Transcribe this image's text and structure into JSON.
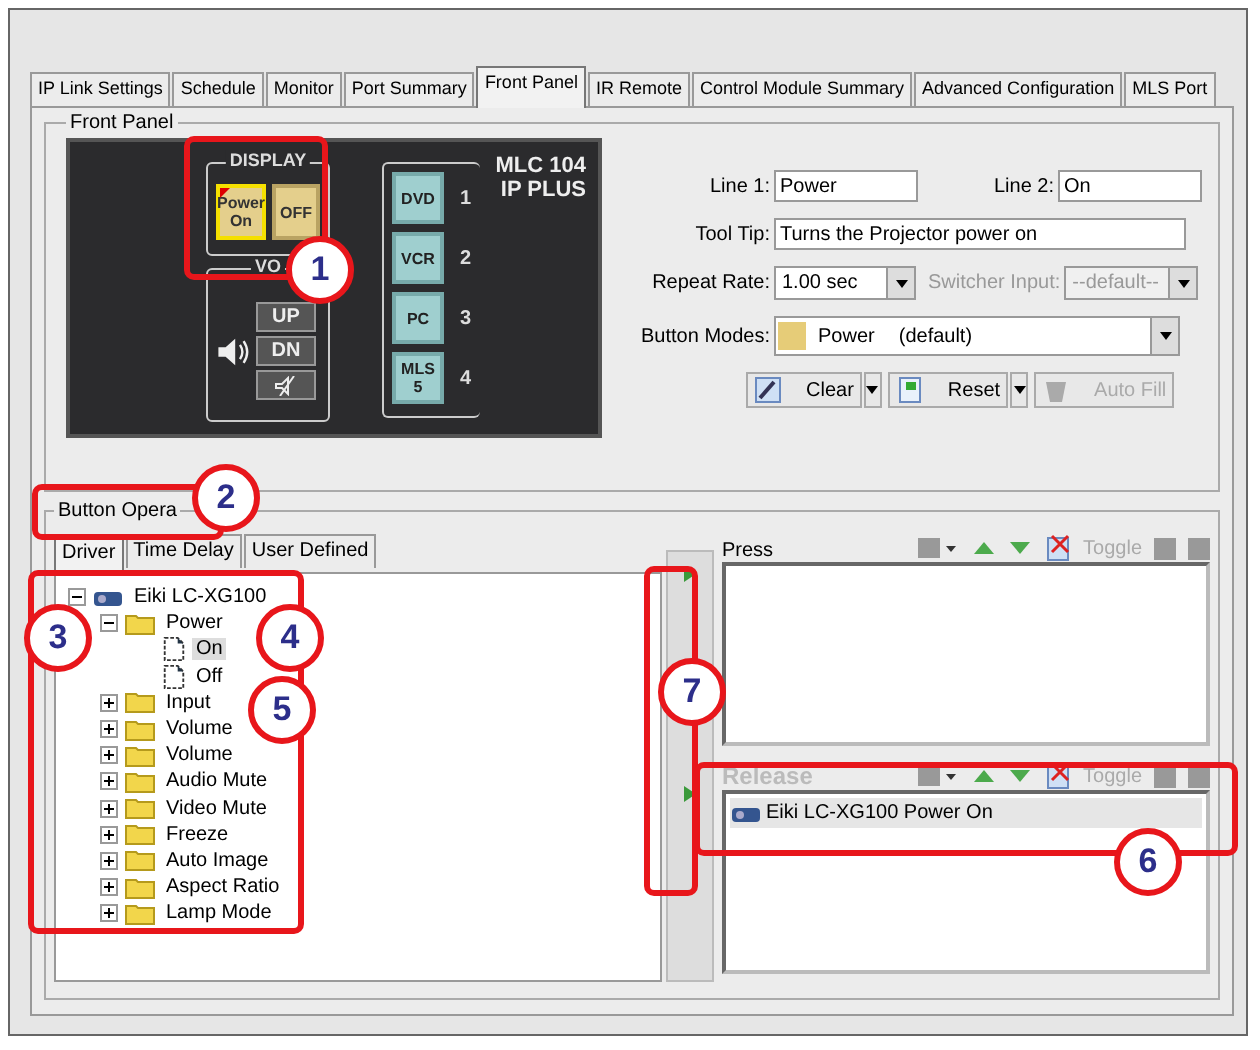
{
  "tabs": [
    {
      "label": "IP Link Settings",
      "selected": false
    },
    {
      "label": "Schedule",
      "selected": false
    },
    {
      "label": "Monitor",
      "selected": false
    },
    {
      "label": "Port Summary",
      "selected": false
    },
    {
      "label": "Front Panel",
      "selected": true
    },
    {
      "label": "IR Remote",
      "selected": false
    },
    {
      "label": "Control Module Summary",
      "selected": false
    },
    {
      "label": "Advanced Configuration",
      "selected": false
    },
    {
      "label": "MLS Port",
      "selected": false
    }
  ],
  "front_panel": {
    "title": "Front Panel",
    "device": {
      "model_line1": "MLC 104",
      "model_line2": "IP PLUS",
      "display": {
        "label": "DISPLAY",
        "buttons": [
          {
            "line1": "Power",
            "line2": "On",
            "selected": true
          },
          {
            "line1": "OFF",
            "selected": false
          }
        ]
      },
      "volume": {
        "label": "VO",
        "up": "UP",
        "down": "DN"
      },
      "inputs": [
        {
          "line1": "DVD",
          "number": "1"
        },
        {
          "line1": "VCR",
          "number": "2"
        },
        {
          "line1": "PC",
          "number": "3"
        },
        {
          "line1": "MLS",
          "line2": "5",
          "number": "4"
        }
      ]
    },
    "form": {
      "line1": {
        "label": "Line 1:",
        "value": "Power"
      },
      "line2": {
        "label": "Line 2:",
        "value": "On"
      },
      "tooltip": {
        "label": "Tool Tip:",
        "value": "Turns the Projector power on"
      },
      "repeat_rate": {
        "label": "Repeat Rate:",
        "value": "1.00 sec"
      },
      "switcher_input": {
        "label": "Switcher Input:",
        "value": "--default--",
        "disabled": true
      },
      "button_modes": {
        "label": "Button Modes:",
        "value": "Power",
        "note": "(default)",
        "color": "#e6cc78"
      },
      "actions": [
        {
          "label": "Clear",
          "kind": "clear",
          "disabled": false
        },
        {
          "label": "Reset",
          "kind": "reset",
          "disabled": false
        },
        {
          "label": "Auto Fill",
          "kind": "autofill",
          "disabled": true
        }
      ]
    }
  },
  "button_operation": {
    "title": "Button Opera",
    "tabs": [
      {
        "label": "Driver",
        "selected": true
      },
      {
        "label": "Time Delay",
        "selected": false
      },
      {
        "label": "User Defined",
        "selected": false
      }
    ],
    "tree": [
      {
        "label": "Eiki LC-XG100",
        "kind": "device",
        "expanded": true,
        "selected": false,
        "children": [
          {
            "label": "Power",
            "kind": "folder",
            "expanded": true,
            "selected": false,
            "children": [
              {
                "label": "On",
                "kind": "command",
                "selected": true
              },
              {
                "label": "Off",
                "kind": "command",
                "selected": false
              }
            ]
          },
          {
            "label": "Input",
            "kind": "folder",
            "expanded": false,
            "selected": false
          },
          {
            "label": "Volume",
            "kind": "folder",
            "expanded": false,
            "selected": false
          },
          {
            "label": "Volume",
            "kind": "folder",
            "expanded": false,
            "selected": false
          },
          {
            "label": "Audio Mute",
            "kind": "folder",
            "expanded": false,
            "selected": false
          },
          {
            "label": "Video Mute",
            "kind": "folder",
            "expanded": false,
            "selected": false
          },
          {
            "label": "Freeze",
            "kind": "folder",
            "expanded": false,
            "selected": false
          },
          {
            "label": "Auto Image",
            "kind": "folder",
            "expanded": false,
            "selected": false
          },
          {
            "label": "Aspect Ratio",
            "kind": "folder",
            "expanded": false,
            "selected": false
          },
          {
            "label": "Lamp Mode",
            "kind": "folder",
            "expanded": false,
            "selected": false
          }
        ]
      }
    ],
    "lists": [
      {
        "label": "Press",
        "disabled": false,
        "toggle": "Toggle"
      },
      {
        "label": "Release",
        "disabled": true,
        "toggle": "Toggle",
        "items": [
          {
            "label": "Eiki LC-XG100 Power On",
            "selected": true
          }
        ]
      }
    ]
  },
  "callouts": [
    {
      "number": "1"
    },
    {
      "number": "2"
    },
    {
      "number": "3"
    },
    {
      "number": "4"
    },
    {
      "number": "5"
    },
    {
      "number": "7"
    },
    {
      "number": "6"
    }
  ]
}
